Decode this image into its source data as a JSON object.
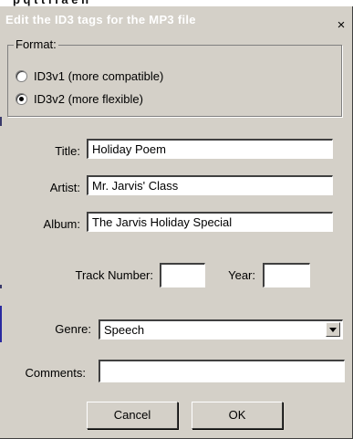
{
  "window": {
    "title": "Edit the ID3 tags for the MP3 file",
    "close_glyph": "×"
  },
  "format": {
    "legend": "Format:",
    "options": [
      {
        "label": "ID3v1 (more compatible)",
        "checked": false
      },
      {
        "label": "ID3v2 (more flexible)",
        "checked": true
      }
    ]
  },
  "fields": {
    "title_label": "Title:",
    "title_value": "Holiday Poem",
    "artist_label": "Artist:",
    "artist_value": "Mr. Jarvis' Class",
    "album_label": "Album:",
    "album_value": "The Jarvis Holiday Special",
    "track_label": "Track Number:",
    "track_value": "",
    "year_label": "Year:",
    "year_value": "",
    "genre_label": "Genre:",
    "genre_value": "Speech",
    "comments_label": "Comments:",
    "comments_value": ""
  },
  "buttons": {
    "cancel": "Cancel",
    "ok": "OK"
  },
  "icons": {
    "close": "close-icon",
    "dropdown": "chevron-down-icon"
  }
}
